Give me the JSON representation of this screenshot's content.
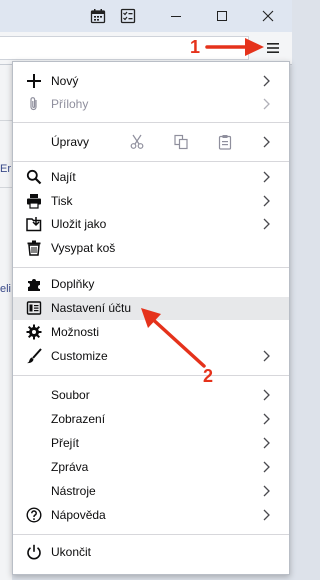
{
  "window_controls": {
    "calendar_icon": "calendar-icon",
    "tasks_icon": "tasks-icon",
    "minimize_icon": "minimize-icon",
    "maximize_icon": "maximize-icon",
    "close_icon": "close-icon"
  },
  "toolbar": {
    "menu_icon": "hamburger-menu-icon"
  },
  "background": {
    "strip_text_1": "Er",
    "strip_text_2": "eli"
  },
  "menu": {
    "new": "Nový",
    "attachments": "Přílohy",
    "edit": "Úpravy",
    "find": "Najít",
    "print": "Tisk",
    "save_as": "Uložit jako",
    "empty_trash": "Vysypat koš",
    "addons": "Doplňky",
    "account_settings": "Nastavení účtu",
    "options": "Možnosti",
    "customize": "Customize",
    "file": "Soubor",
    "view": "Zobrazení",
    "go": "Přejít",
    "message": "Zpráva",
    "tools": "Nástroje",
    "help": "Nápověda",
    "quit": "Ukončit"
  },
  "annotations": {
    "step1": "1",
    "step2": "2",
    "color": "#e5321b"
  }
}
